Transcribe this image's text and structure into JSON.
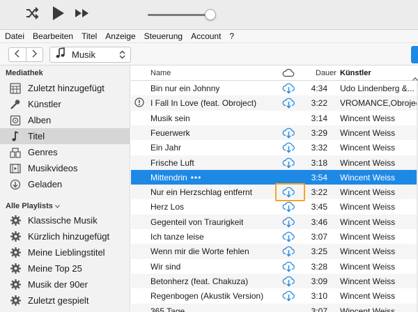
{
  "menu": [
    "Datei",
    "Bearbeiten",
    "Titel",
    "Anzeige",
    "Steuerung",
    "Account",
    "?"
  ],
  "toolbar": {
    "icons": [
      "shuffle-icon",
      "play-icon",
      "fast-forward-icon",
      "volume-slider"
    ],
    "volume_level": 0.88
  },
  "navbar": {
    "media_label": "Musik",
    "icons": [
      "back-arrow-icon",
      "forward-arrow-icon",
      "music-note-icon",
      "updown-chevron-icon"
    ]
  },
  "sidebar": {
    "library_heading": "Mediathek",
    "library_items": [
      {
        "label": "Zuletzt hinzugefügt",
        "icon": "recently-added-icon"
      },
      {
        "label": "Künstler",
        "icon": "microphone-icon"
      },
      {
        "label": "Alben",
        "icon": "album-icon"
      },
      {
        "label": "Titel",
        "icon": "music-note-icon",
        "selected": true
      },
      {
        "label": "Genres",
        "icon": "genres-icon"
      },
      {
        "label": "Musikvideos",
        "icon": "video-icon"
      },
      {
        "label": "Geladen",
        "icon": "download-icon"
      }
    ],
    "playlists_heading": "Alle Playlists",
    "playlist_items": [
      {
        "label": "Klassische Musik",
        "icon": "gear-icon"
      },
      {
        "label": "Kürzlich hinzugefügt",
        "icon": "gear-icon"
      },
      {
        "label": "Meine Lieblingstitel",
        "icon": "gear-icon"
      },
      {
        "label": "Meine Top 25",
        "icon": "gear-icon"
      },
      {
        "label": "Musik der 90er",
        "icon": "gear-icon"
      },
      {
        "label": "Zuletzt gespielt",
        "icon": "gear-icon"
      }
    ]
  },
  "tracklist": {
    "headers": {
      "name": "Name",
      "duration": "Dauer",
      "artist": "Künstler"
    },
    "accent_color": "#1e88e5",
    "highlight_color": "#f5a623",
    "rows": [
      {
        "name": "Bin nur ein Johnny",
        "duration": "4:34",
        "artist": "Udo Lindenberg &...",
        "cloud": true
      },
      {
        "name": "I Fall In Love (feat. Obroject)",
        "duration": "3:22",
        "artist": "VROMANCE,Obroject",
        "cloud": true,
        "warning": true
      },
      {
        "name": "Musik sein",
        "duration": "3:14",
        "artist": "Wincent Weiss",
        "cloud": false
      },
      {
        "name": "Feuerwerk",
        "duration": "3:29",
        "artist": "Wincent Weiss",
        "cloud": true
      },
      {
        "name": "Ein Jahr",
        "duration": "3:32",
        "artist": "Wincent Weiss",
        "cloud": true
      },
      {
        "name": "Frische Luft",
        "duration": "3:18",
        "artist": "Wincent Weiss",
        "cloud": true
      },
      {
        "name": "Mittendrin",
        "duration": "3:54",
        "artist": "Wincent Weiss",
        "cloud": false,
        "selected": true,
        "more": "•••"
      },
      {
        "name": "Nur ein Herzschlag entfernt",
        "duration": "3:22",
        "artist": "Wincent Weiss",
        "cloud": true,
        "highlighted": true
      },
      {
        "name": "Herz Los",
        "duration": "3:45",
        "artist": "Wincent Weiss",
        "cloud": true
      },
      {
        "name": "Gegenteil von Traurigkeit",
        "duration": "3:46",
        "artist": "Wincent Weiss",
        "cloud": true
      },
      {
        "name": "Ich tanze leise",
        "duration": "3:07",
        "artist": "Wincent Weiss",
        "cloud": true
      },
      {
        "name": "Wenn mir die Worte fehlen",
        "duration": "3:25",
        "artist": "Wincent Weiss",
        "cloud": true
      },
      {
        "name": "Wir sind",
        "duration": "3:28",
        "artist": "Wincent Weiss",
        "cloud": true
      },
      {
        "name": "Betonherz (feat. Chakuza)",
        "duration": "3:09",
        "artist": "Wincent Weiss",
        "cloud": true
      },
      {
        "name": "Regenbogen (Akustik Version)",
        "duration": "3:10",
        "artist": "Wincent Weiss",
        "cloud": true
      },
      {
        "name": "365 Tage",
        "duration": "3:07",
        "artist": "Wincent Weiss",
        "cloud": false
      }
    ]
  }
}
